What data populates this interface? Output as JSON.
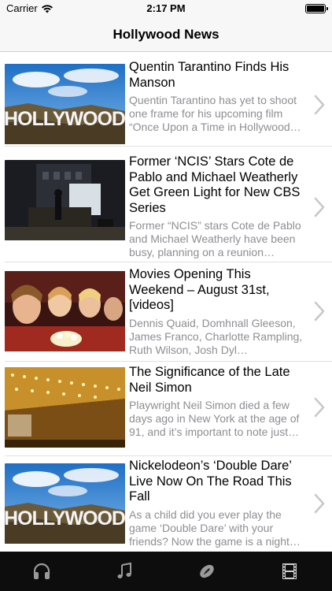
{
  "status_bar": {
    "carrier": "Carrier",
    "time": "2:17 PM"
  },
  "nav": {
    "title": "Hollywood News"
  },
  "articles": [
    {
      "title": "Quentin Tarantino Finds His Manson",
      "description": "Quentin Tarantino has yet to shoot one frame for his upcoming film “Once Upon a Time in Hollywood…",
      "image": "hollywood-sign",
      "image_text": "HOLLYWOOD"
    },
    {
      "title": "Former ‘NCIS’ Stars Cote de Pablo and Michael Weatherly Get Green Light for New CBS Series",
      "description": "Former “NCIS” stars Cote de Pablo and Michael Weatherly have been busy, planning on a reunion…",
      "image": "film-set-night"
    },
    {
      "title": "Movies Opening This Weekend – August 31st, [videos]",
      "description": "Dennis Quaid, Domhnall Gleeson, James Franco, Charlotte Rampling, Ruth Wilson, Josh Dyl…",
      "image": "movie-audience"
    },
    {
      "title": "The Significance of the Late Neil Simon",
      "description": "Playwright Neil Simon died a few days ago in New York at the age of 91, and it’s important to note just…",
      "image": "theater-marquee"
    },
    {
      "title": "Nickelodeon’s ‘Double Dare’ Live Now On The Road This Fall",
      "description": "As a child did you ever play the game ‘Double Dare’ with your friends? Now the game is a night…",
      "image": "hollywood-sign",
      "image_text": "HOLLYWOOD"
    }
  ],
  "tabs": [
    {
      "icon": "headphones-icon"
    },
    {
      "icon": "music-note-icon"
    },
    {
      "icon": "football-icon"
    },
    {
      "icon": "film-strip-icon"
    }
  ]
}
